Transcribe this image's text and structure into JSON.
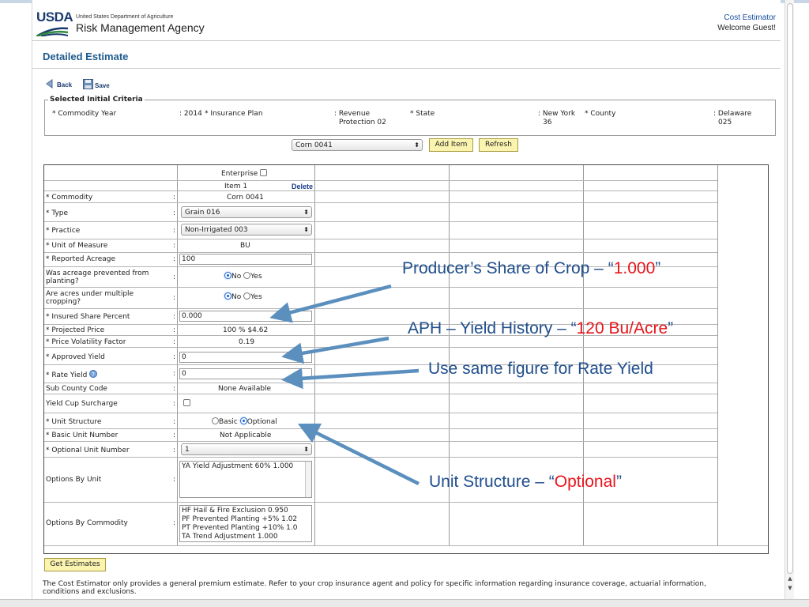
{
  "header": {
    "logo": "USDA",
    "department": "United States Department of Agriculture",
    "agency": "Risk Management Agency",
    "app_name": "Cost Estimator",
    "welcome": "Welcome Guest!"
  },
  "page": {
    "title": "Detailed Estimate"
  },
  "toolbar": {
    "back_label": "Back",
    "save_label": "Save"
  },
  "criteria": {
    "legend": "Selected Initial Criteria",
    "commodity_year_label": "* Commodity Year",
    "commodity_year_value": ": 2014",
    "insurance_plan_label": "* Insurance Plan",
    "insurance_plan_value_1": ": Revenue",
    "insurance_plan_value_2": "Protection 02",
    "state_label": "* State",
    "state_value_1": ": New York",
    "state_value_2": "36",
    "county_label": "* County",
    "county_value_1": ": Delaware",
    "county_value_2": "025"
  },
  "add_bar": {
    "commodity_select": "Corn 0041",
    "add_item_label": "Add Item",
    "refresh_label": "Refresh"
  },
  "grid": {
    "enterprise_label": "Enterprise",
    "item_label": "Item 1",
    "delete_label": "Delete",
    "rows": {
      "commodity": {
        "label": "* Commodity",
        "value": "Corn 0041"
      },
      "type": {
        "label": "* Type",
        "value": "Grain 016"
      },
      "practice": {
        "label": "* Practice",
        "value": "Non-Irrigated 003"
      },
      "unit_of_measure": {
        "label": "* Unit of Measure",
        "value": "BU"
      },
      "reported_acreage": {
        "label": "* Reported Acreage",
        "value": "100"
      },
      "prevented_planting": {
        "label_1": "Was acreage prevented from",
        "label_2": "planting?"
      },
      "multiple_cropping": {
        "label_1": "Are acres under multiple",
        "label_2": "cropping?"
      },
      "radio_no": "No",
      "radio_yes": "Yes",
      "insured_share": {
        "label": "* Insured Share Percent",
        "value": "0.000"
      },
      "projected_price": {
        "label": "* Projected Price",
        "value": "100 % $4.62"
      },
      "price_volatility": {
        "label": "* Price Volatility Factor",
        "value": "0.19"
      },
      "approved_yield": {
        "label": "* Approved Yield",
        "value": "0"
      },
      "rate_yield": {
        "label": "* Rate Yield",
        "value": "0"
      },
      "sub_county": {
        "label": "Sub County Code",
        "value": "None Available"
      },
      "yield_cup": {
        "label": "Yield Cup Surcharge"
      },
      "unit_structure": {
        "label": "* Unit Structure",
        "basic": "Basic",
        "optional": "Optional"
      },
      "basic_unit_number": {
        "label": "* Basic Unit Number",
        "value": "Not Applicable"
      },
      "optional_unit_number": {
        "label": "* Optional Unit Number",
        "value": "1"
      },
      "options_by_unit": {
        "label": "Options By Unit",
        "items": [
          "YA Yield Adjustment 60% 1.000"
        ]
      },
      "options_by_commodity": {
        "label": "Options By Commodity",
        "items": [
          "HF Hail & Fire Exclusion 0.950",
          "PF Prevented Planting +5% 1.02",
          "PT Prevented Planting +10% 1.0",
          "TA Trend Adjustment 1.000"
        ]
      }
    }
  },
  "get_estimates_label": "Get Estimates",
  "footer": {
    "line_1": "The Cost Estimator only provides a general premium estimate. Refer to your crop insurance agent and policy for specific information regarding insurance coverage, actuarial information,",
    "line_2": "conditions and exclusions."
  },
  "annotations": {
    "share": {
      "text": "Producer’s Share of Crop – “",
      "highlight": "1.000",
      "end": "”"
    },
    "aph": {
      "text": "APH – Yield History – “",
      "highlight": "120 Bu/Acre",
      "end": "”"
    },
    "rate": {
      "text": "Use same figure for Rate Yield"
    },
    "unit": {
      "text": "Unit Structure – “",
      "highlight": "Optional",
      "end": "”"
    }
  },
  "colors": {
    "annotation_text": "#1f4e8c",
    "annotation_highlight": "#e8141a",
    "arrow": "#5b8fbe",
    "title": "#1e5a8e",
    "button": "#fbf3b0"
  }
}
